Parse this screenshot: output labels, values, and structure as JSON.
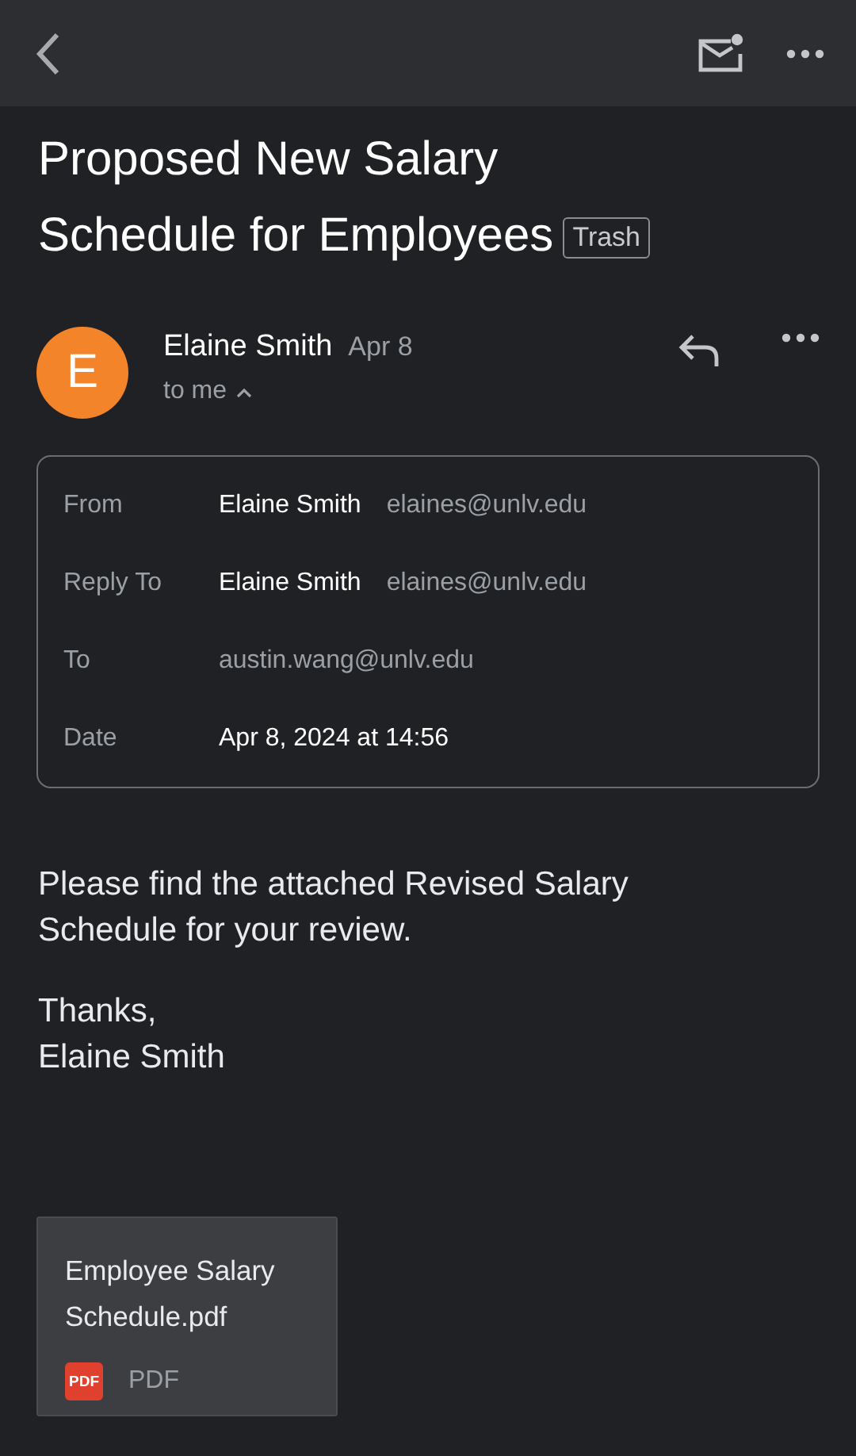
{
  "subject": "Proposed New Salary Schedule for Employees",
  "label": "Trash",
  "message": {
    "avatar_letter": "E",
    "sender": "Elaine Smith",
    "date": "Apr 8",
    "recipient": "to me",
    "details_expanded": true
  },
  "details": [
    {
      "label": "From",
      "name": "Elaine Smith",
      "email": "elaines@unlv.edu"
    },
    {
      "label": "Reply To",
      "name": "Elaine Smith",
      "email": "elaines@unlv.edu"
    },
    {
      "label": "To",
      "email": "austin.wang@unlv.edu"
    },
    {
      "label": "Date",
      "name": "Apr 8, 2024 at 14:56"
    }
  ],
  "body": [
    "Please find the attached Revised Salary Schedule for your review.",
    "Thanks,\nElaine Smith"
  ],
  "attachment": {
    "file_name": "Employee Salary Schedule.pdf",
    "icon_label": "PDF",
    "type": "PDF"
  }
}
